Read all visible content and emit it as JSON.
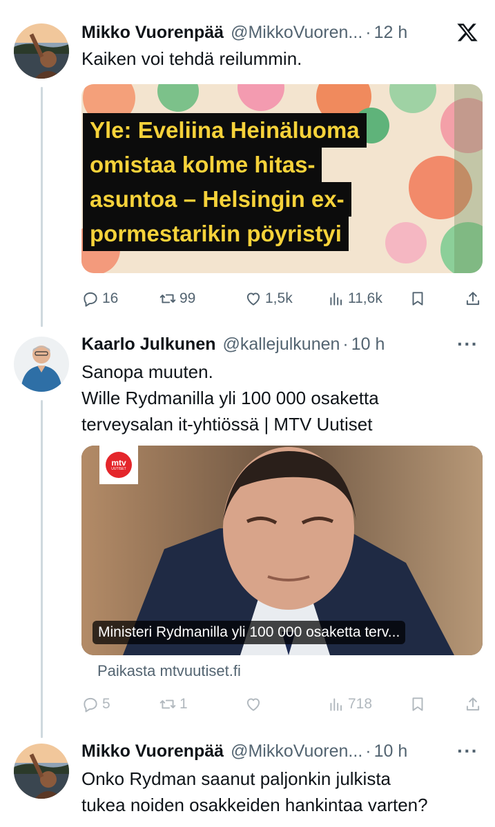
{
  "tweets": [
    {
      "name": "Mikko Vuorenpää",
      "handle": "@MikkoVuoren...",
      "time": "12 h",
      "text": "Kaiken voi tehdä reilummin.",
      "media_headline": [
        "Yle: Eveliina Heinäluoma",
        "omistaa kolme hitas-",
        "asuntoa – Helsingin ex-",
        "pormestarikin pöyristyi"
      ],
      "stats": {
        "replies": "16",
        "retweets": "99",
        "likes": "1,5k",
        "views": "11,6k"
      }
    },
    {
      "name": "Kaarlo Julkunen",
      "handle": "@kallejulkunen",
      "time": "10 h",
      "text_lines": [
        "Sanopa muuten.",
        "Wille Rydmanilla yli 100 000 osaketta",
        "terveysalan it-yhtiössä | MTV Uutiset"
      ],
      "card_logo_top": "mtv",
      "card_logo_bottom": "UUTISET",
      "card_caption": "Ministeri Rydmanilla yli 100 000 osaketta terv...",
      "card_source": "Paikasta mtvuutiset.fi",
      "stats": {
        "replies": "5",
        "retweets": "1",
        "likes": "",
        "views": "718"
      }
    },
    {
      "name": "Mikko Vuorenpää",
      "handle": "@MikkoVuoren...",
      "time": "10 h",
      "text_lines": [
        "Onko Rydman saanut paljonkin julkista",
        "tukea noiden osakkeiden hankintaa varten?"
      ]
    }
  ],
  "colors": {
    "text": "#0f1419",
    "muted": "#536471",
    "thread_line": "#cfd9de",
    "headline_yellow": "#f6d23a",
    "mtv_red": "#e4262b"
  },
  "icons": {
    "platform": "x-logo-icon",
    "more": "more-icon"
  },
  "more_label": "···",
  "separator": "·"
}
